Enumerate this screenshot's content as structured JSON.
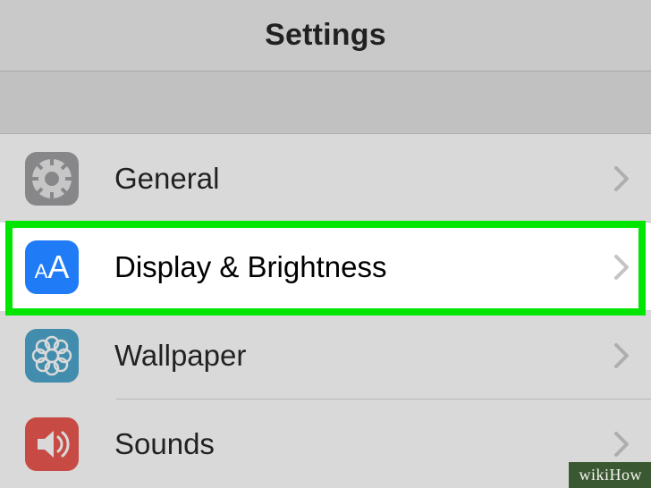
{
  "header": {
    "title": "Settings"
  },
  "rows": {
    "general": {
      "label": "General",
      "icon": "gear-icon"
    },
    "display": {
      "label": "Display & Brightness",
      "icon": "text-size-icon"
    },
    "wallpaper": {
      "label": "Wallpaper",
      "icon": "flower-icon"
    },
    "sounds": {
      "label": "Sounds",
      "icon": "speaker-icon"
    }
  },
  "colors": {
    "highlight": "#00e600",
    "general_icon_bg": "#8e8e92",
    "display_icon_bg": "#1f7cf6",
    "wallpaper_icon_bg": "#2f95c3",
    "sounds_icon_bg": "#e63b31"
  },
  "watermark": "wikiHow"
}
